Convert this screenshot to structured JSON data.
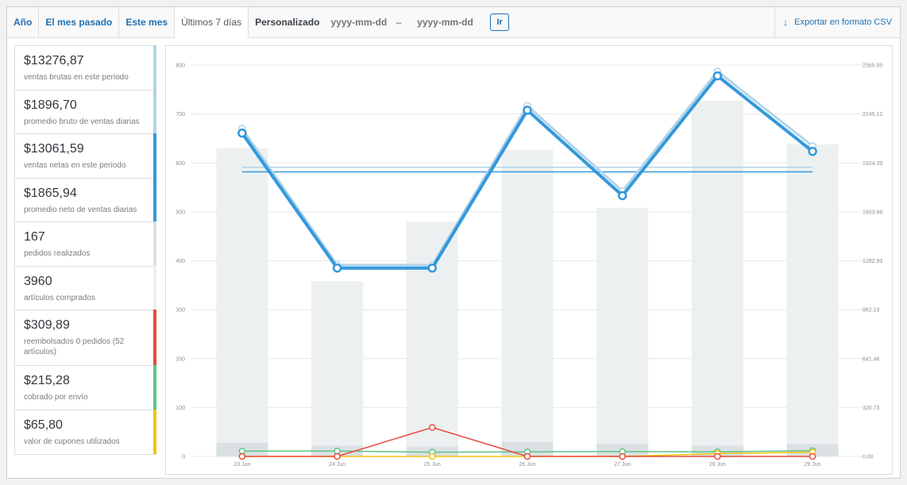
{
  "tabs": [
    {
      "label": "Año",
      "active": false
    },
    {
      "label": "El mes pasado",
      "active": false
    },
    {
      "label": "Este mes",
      "active": false
    },
    {
      "label": "Últimos 7 días",
      "active": true
    }
  ],
  "custom_range": {
    "label": "Personalizado",
    "start_placeholder": "yyyy-mm-dd",
    "separator": "–",
    "end_placeholder": "yyyy-mm-dd",
    "go_label": "Ir"
  },
  "export": {
    "label": "Exportar en formato CSV",
    "icon": "download-icon"
  },
  "legend": [
    {
      "amount": "$13276,87",
      "desc": "ventas brutas en este periodo",
      "color": "#b1d4ea"
    },
    {
      "amount": "$1896,70",
      "desc": "promedio bruto de ventas diarias",
      "color": "#b1d4ea"
    },
    {
      "amount": "$13061,59",
      "desc": "ventas netas en este periodo",
      "color": "#3498db"
    },
    {
      "amount": "$1865,94",
      "desc": "promedio neto de ventas diarias",
      "color": "#3498db"
    },
    {
      "amount": "167",
      "desc": "pedidos realizados",
      "color": "#dbe1e3"
    },
    {
      "amount": "3960",
      "desc": "artículos comprados",
      "color": "#ecf0f1"
    },
    {
      "amount": "$309,89",
      "desc": "reembolsados 0 pedidos (52 artículos)",
      "color": "#e74c3c"
    },
    {
      "amount": "$215,28",
      "desc": "cobrado por envío",
      "color": "#5cc488"
    },
    {
      "amount": "$65,80",
      "desc": "valor de cupones utilizados",
      "color": "#f1c40f"
    }
  ],
  "chart_data": {
    "type": "bar",
    "categories": [
      "23 Jun",
      "24 Jun",
      "25 Jun",
      "26 Jun",
      "27 Jun",
      "28 Jun",
      "29 Jun"
    ],
    "y_left": {
      "ticks": [
        "0",
        "100",
        "200",
        "300",
        "400",
        "500",
        "600",
        "700",
        "800"
      ],
      "ylim": [
        0,
        800
      ]
    },
    "y_right": {
      "ticks": [
        "0.00",
        "320.73",
        "641.46",
        "962.19",
        "1282.93",
        "1603.66",
        "1924.39",
        "2245.12",
        "2565.85"
      ],
      "ylim": [
        0,
        2565.85
      ]
    },
    "grid": true,
    "series": [
      {
        "key": "items",
        "axis": "left",
        "kind": "bar",
        "color": "#ecf0f1",
        "values": [
          630,
          358,
          480,
          627,
          508,
          727,
          638
        ]
      },
      {
        "key": "orders",
        "axis": "left",
        "kind": "bar",
        "color": "#dbe1e3",
        "values": [
          28,
          22,
          20,
          30,
          26,
          22,
          25
        ]
      },
      {
        "key": "gross",
        "axis": "right",
        "kind": "line",
        "color": "#b1d4ea",
        "values": [
          2150,
          1255,
          1255,
          2300,
          1740,
          2525,
          2035
        ]
      },
      {
        "key": "net",
        "axis": "right",
        "kind": "line",
        "color": "#3498db",
        "values": [
          2120,
          1235,
          1235,
          2270,
          1710,
          2495,
          2000
        ]
      },
      {
        "key": "gross_avg",
        "axis": "right",
        "kind": "avg",
        "color": "#b1d4ea",
        "values": [
          1896.7
        ]
      },
      {
        "key": "net_avg",
        "axis": "right",
        "kind": "avg",
        "color": "#3498db",
        "values": [
          1865.94
        ]
      },
      {
        "key": "shipping",
        "axis": "right",
        "kind": "line",
        "color": "#5cc488",
        "values": [
          35,
          35,
          28,
          30,
          32,
          30,
          38
        ]
      },
      {
        "key": "coupons",
        "axis": "right",
        "kind": "line",
        "color": "#f1c40f",
        "values": [
          0,
          0,
          0,
          0,
          0,
          18,
          28
        ]
      },
      {
        "key": "refunds",
        "axis": "right",
        "kind": "line",
        "color": "#e74c3c",
        "values": [
          0,
          0,
          190,
          0,
          0,
          0,
          0
        ]
      }
    ]
  }
}
